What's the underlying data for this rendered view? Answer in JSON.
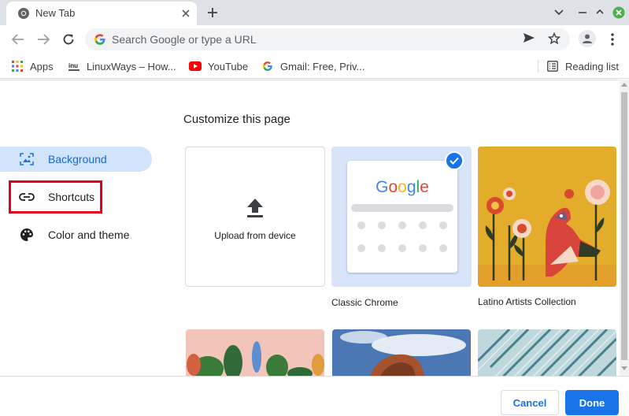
{
  "tab": {
    "title": "New Tab"
  },
  "omnibox": {
    "placeholder": "Search Google or type a URL"
  },
  "bookmarks": {
    "items": [
      {
        "label": "Apps",
        "icon": "apps-grid-icon"
      },
      {
        "label": "LinuxWays – How...",
        "icon": "linuxways-icon"
      },
      {
        "label": "YouTube",
        "icon": "youtube-icon"
      },
      {
        "label": "Gmail: Free, Priv...",
        "icon": "google-icon"
      }
    ],
    "reading_list": "Reading list"
  },
  "dialog": {
    "title": "Customize this page",
    "sidebar": [
      {
        "label": "Background",
        "icon": "image-icon",
        "selected": true
      },
      {
        "label": "Shortcuts",
        "icon": "link-icon",
        "selected": false
      },
      {
        "label": "Color and theme",
        "icon": "palette-icon",
        "selected": false
      }
    ],
    "tiles": {
      "upload_label": "Upload from device",
      "classic_chrome": "Classic Chrome",
      "latino_collection": "Latino Artists Collection",
      "google_logo": "Google"
    },
    "buttons": {
      "cancel": "Cancel",
      "done": "Done"
    }
  },
  "colors": {
    "accent": "#1a73e8",
    "selected_bg": "#d2e3fc",
    "highlight_box": "#e2001a",
    "tabstrip": "#dee1e6"
  }
}
